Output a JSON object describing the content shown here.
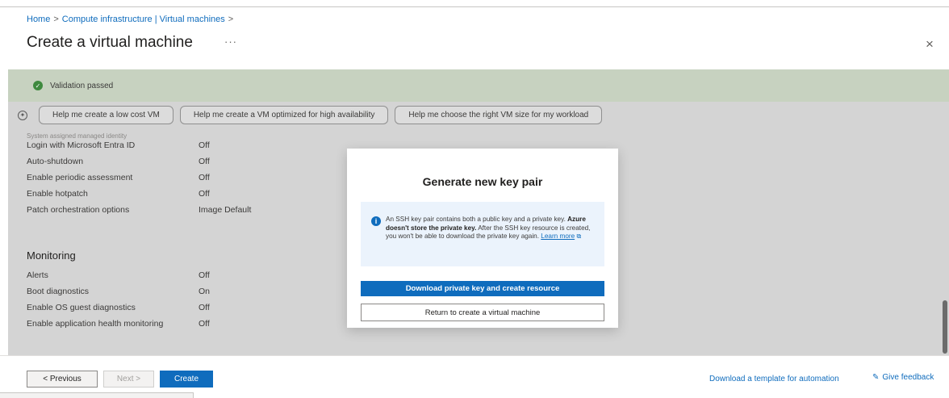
{
  "breadcrumb": {
    "items": [
      "Home",
      "Compute infrastructure | Virtual machines"
    ],
    "separator": ">"
  },
  "page": {
    "title": "Create a virtual machine",
    "more": "···",
    "close": "×"
  },
  "validation": {
    "message": "Validation passed",
    "status_color": "#3f8a3f"
  },
  "suggestions": [
    "Help me create a low cost VM",
    "Help me create a VM optimized for high availability",
    "Help me choose the right VM size for my workload"
  ],
  "settings": {
    "cutoff_row": "System assigned managed identity",
    "rows": [
      {
        "key": "Login with Microsoft Entra ID",
        "value": "Off"
      },
      {
        "key": "Auto-shutdown",
        "value": "Off"
      },
      {
        "key": "Enable periodic assessment",
        "value": "Off"
      },
      {
        "key": "Enable hotpatch",
        "value": "Off"
      },
      {
        "key": "Patch orchestration options",
        "value": "Image Default"
      }
    ],
    "monitoring_title": "Monitoring",
    "monitoring_rows": [
      {
        "key": "Alerts",
        "value": "Off"
      },
      {
        "key": "Boot diagnostics",
        "value": "On"
      },
      {
        "key": "Enable OS guest diagnostics",
        "value": "Off"
      },
      {
        "key": "Enable application health monitoring",
        "value": "Off"
      }
    ]
  },
  "modal": {
    "title": "Generate new key pair",
    "info_part1": "An SSH key pair contains both a public key and a private key. ",
    "info_bold": "Azure doesn't store the private key.",
    "info_part2": " After the SSH key resource is created, you won't be able to download the private key again. ",
    "info_link": "Learn more",
    "primary_button": "Download private key and create resource",
    "secondary_button": "Return to create a virtual machine"
  },
  "footer": {
    "previous": "< Previous",
    "next": "Next >",
    "create": "Create",
    "template_link": "Download a template for automation",
    "feedback": "Give feedback"
  },
  "colors": {
    "accent": "#0f6cbd",
    "info_background": "#ebf3fc"
  }
}
